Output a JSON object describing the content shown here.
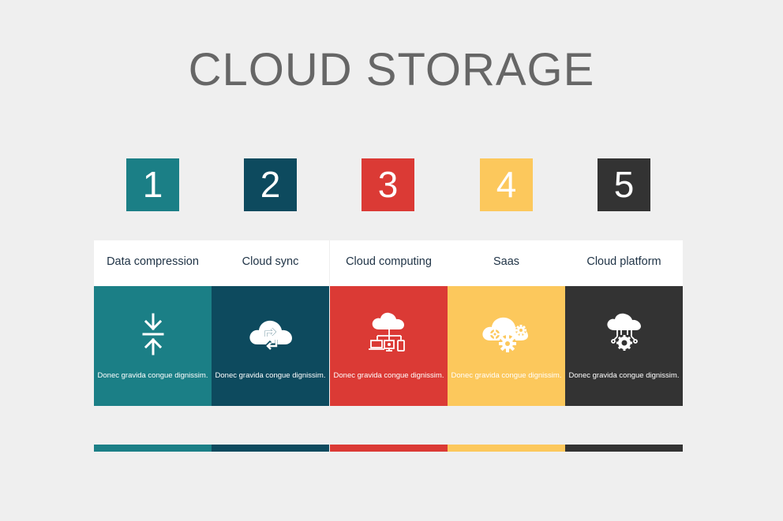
{
  "title": "CLOUD STORAGE",
  "colors": {
    "background": "#efefef",
    "teal": "#1b7f86",
    "navy": "#0d4a5e",
    "red": "#db3a35",
    "yellow": "#fcc85c",
    "dark": "#333333"
  },
  "steps": [
    {
      "number": "1",
      "label": "Data compression",
      "icon": "compress-arrows-icon",
      "description": "Donec gravida congue dignissim.",
      "color": "#1b7f86"
    },
    {
      "number": "2",
      "label": "Cloud sync",
      "icon": "cloud-sync-icon",
      "description": "Donec gravida congue dignissim.",
      "color": "#0d4a5e"
    },
    {
      "number": "3",
      "label": "Cloud computing",
      "icon": "cloud-network-icon",
      "description": "Donec gravida congue dignissim.",
      "color": "#db3a35"
    },
    {
      "number": "4",
      "label": "Saas",
      "icon": "cloud-gears-icon",
      "description": "Donec gravida congue dignissim.",
      "color": "#fcc85c"
    },
    {
      "number": "5",
      "label": "Cloud platform",
      "icon": "cloud-circuit-icon",
      "description": "Donec gravida congue dignissim.",
      "color": "#333333"
    }
  ]
}
